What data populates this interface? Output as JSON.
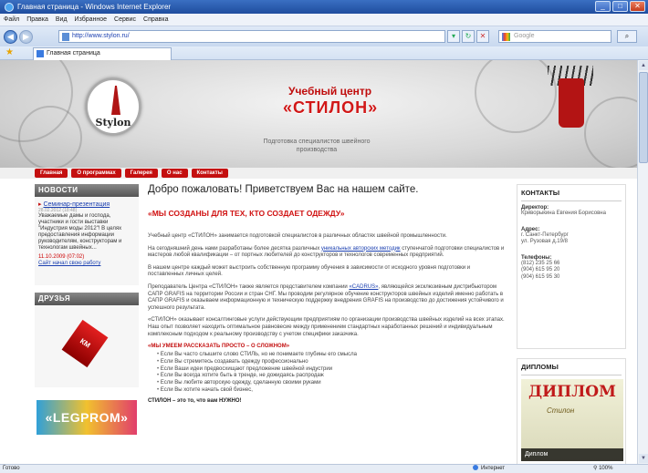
{
  "window": {
    "title": "Главная страница - Windows Internet Explorer"
  },
  "menu": [
    "Файл",
    "Правка",
    "Вид",
    "Избранное",
    "Сервис",
    "Справка"
  ],
  "address": {
    "url": "http://www.stylon.ru/",
    "search_placeholder": "Google"
  },
  "tab": {
    "title": "Главная страница"
  },
  "status": {
    "left": "Готово",
    "zone": "Интернет",
    "zoom": "100%"
  },
  "site": {
    "logo_text": "Stylon",
    "subtitle": "Учебный центр",
    "brand": "«СТИЛОН»",
    "tagline": "Подготовка специалистов швейного производства"
  },
  "nav": [
    "Главная",
    "О программах",
    "Галерея",
    "О нас",
    "Контакты"
  ],
  "news": {
    "title": "НОВОСТИ",
    "item1_link": "Семинар-презентация",
    "item1_date": "28.02.2012 (18:48)",
    "item1_text": "Уважаемые дамы и господа, участники и гости выставки \"Индустрия моды 2012\"! В целях предоставления информации руководителям, конструкторам и технологам швейных...",
    "item2_date": "11.10.2009 (07:02)",
    "item2_link": "Сайт начал свою работу"
  },
  "friends": {
    "title": "ДРУЗЬЯ",
    "banner1": "КМ",
    "banner2": "«LEGPROM»"
  },
  "main": {
    "heading": "Добро пожаловать! Приветствуем Вас на нашем сайте.",
    "slogan": "«МЫ СОЗДАНЫ ДЛЯ ТЕХ, КТО СОЗДАЕТ ОДЕЖДУ»",
    "p1": "Учебный центр «СТИЛОН» занимается подготовкой специалистов в различных областях швейной промышленности.",
    "p2_before": "На сегодняшний день нами разработаны более десятка различных ",
    "p2_link": "уникальных авторских методик",
    "p2_after": " ступенчатой подготовки специалистов и мастеров любой квалификации – от портных любителей до конструкторов и технологов современных предприятий.",
    "p3": "В нашем центре каждый может выстроить собственную программу обучения в зависимости от исходного уровня подготовки и поставленных личных целей.",
    "p4_before": "Преподаватель Центра «СТИЛОН» также является представителем компании ",
    "p4_link": "«CADRUS»",
    "p4_after": ", являющейся эксклюзивным дистрибьютором САПР GRAFIS на территории России и стран СНГ. Мы проводим регулярное обучение конструкторов швейных изделий именно работать в САПР GRAFIS и оказываем информационную и техническую поддержку внедрения GRAFIS на производство до достижения устойчивого и успешного результата.",
    "p5": "«СТИЛОН» оказывает консалтинговые услуги действующим предприятиям по организации производства швейных изделий на всех этапах. Наш опыт позволяет находить оптимальное равновесие между применением стандартных наработанных решений и индивидуальным комплексным подходом к реальному производству с учетом специфики заказчика.",
    "subhead": "«МЫ УМЕЕМ РАССКАЗАТЬ ПРОСТО – О СЛОЖНОМ»",
    "bullets": [
      "Если Вы часто слышите слово СТИЛЬ, но не понимаете глубины его смысла",
      "Если Вы стремитесь создавать одежду профессионально",
      "Если Ваши идеи предвосхищают предложение швейной индустрии",
      "Если Вы всегда хотите быть в тренде, не дожидаясь распродаж",
      "Если Вы любите авторскую одежду, сделанную своими руками",
      "Если Вы хотите начать свой бизнес,"
    ],
    "final": "СТИЛОН – это то, что вам НУЖНО!"
  },
  "contacts": {
    "title": "КОНТАКТЫ",
    "director_label": "Директор:",
    "director": "Криворыкина Евгения Борисовна",
    "address_label": "Адрес:",
    "address_line1": "г. Санкт-Петербург",
    "address_line2": "ул. Рузовая д.19/8",
    "phones_label": "Телефоны:",
    "phone1": "(812) 235 25 66",
    "phone2": "(904) 615 95 20",
    "phone3": "(904) 615 95 30"
  },
  "diplomas": {
    "title": "ДИПЛОМЫ",
    "image_text": "ДИПЛОМ",
    "image_script": "Стилон",
    "caption": "Диплом"
  }
}
